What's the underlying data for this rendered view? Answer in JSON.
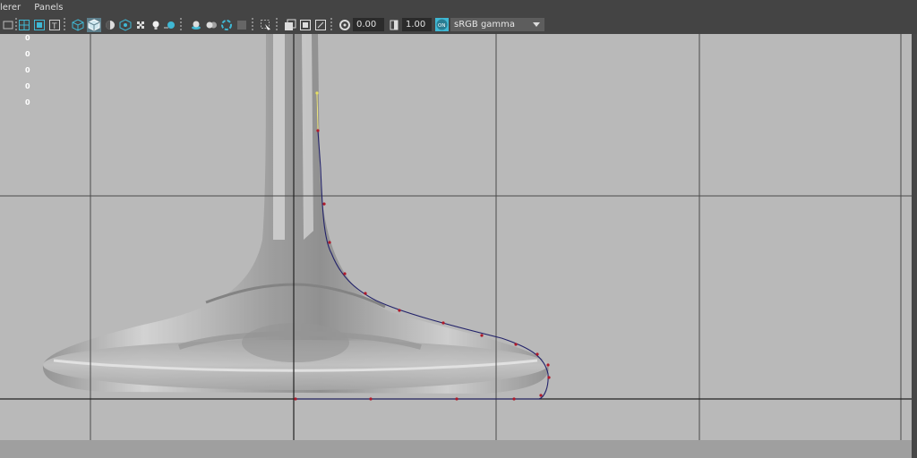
{
  "menubar": {
    "items": [
      "lerer",
      "Panels"
    ]
  },
  "toolbar": {
    "icons": [
      "camera-icon",
      "grid-icon",
      "resolution-gate-icon",
      "film-gate-icon",
      "wireframe-icon",
      "smooth-shade-icon",
      "xray-icon",
      "isolate-icon",
      "texture-icon",
      "lights-icon",
      "shadows-icon",
      "ambient-occlusion-icon",
      "motion-blur-icon",
      "anti-alias-icon",
      "depth-of-field-icon",
      "select-icon",
      "snapshot-icon",
      "playblast-icon",
      "frame-icon",
      "exposure-icon",
      "gamma-icon",
      "color-management-icon"
    ],
    "exposure_value": "0.00",
    "gamma_value": "1.00",
    "color_management_badge": "ON",
    "color_space": "sRGB gamma"
  },
  "hud": {
    "values": [
      "0",
      "0",
      "0",
      "0",
      "0"
    ]
  },
  "colors": {
    "viewport_bg": "#b9b9b9",
    "accent": "#3fb8d4",
    "curve": "#222266",
    "cv_point": "#b01a2a",
    "gridline": "#3a3a3a"
  }
}
